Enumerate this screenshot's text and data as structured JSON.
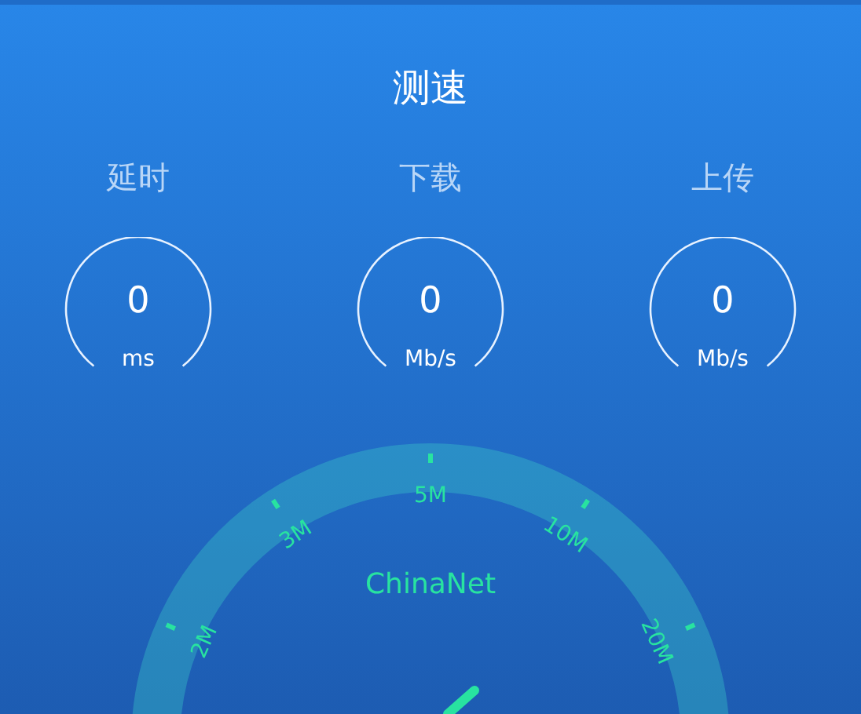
{
  "title": "测速",
  "metrics": [
    {
      "label": "延时",
      "value": "0",
      "unit": "ms"
    },
    {
      "label": "下载",
      "value": "0",
      "unit": "Mb/s"
    },
    {
      "label": "上传",
      "value": "0",
      "unit": "Mb/s"
    }
  ],
  "gauge": {
    "isp": "ChinaNet",
    "scale": [
      {
        "label": "2M"
      },
      {
        "label": "3M"
      },
      {
        "label": "5M"
      },
      {
        "label": "10M"
      },
      {
        "label": "20M"
      }
    ]
  }
}
